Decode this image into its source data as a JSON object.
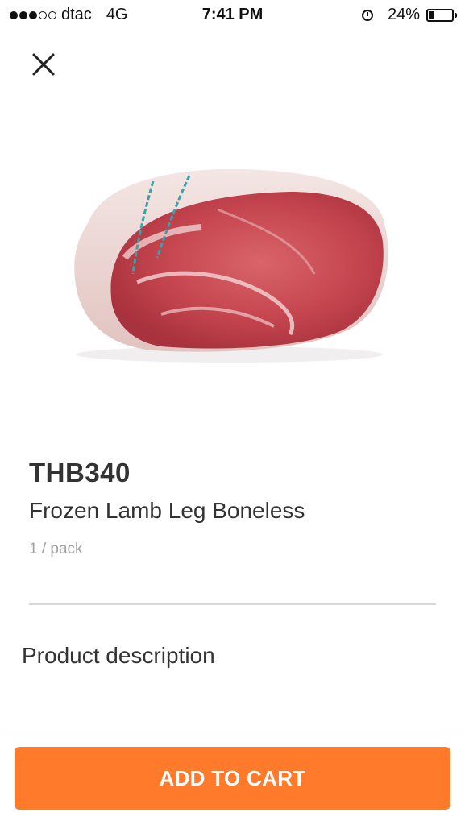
{
  "status_bar": {
    "carrier": "dtac",
    "network": "4G",
    "time": "7:41 PM",
    "battery_percent": "24%",
    "battery_level": 0.24,
    "signal_strength": 3,
    "signal_max": 5,
    "alarm_icon": "alarm-clock-icon"
  },
  "header": {
    "close_icon": "close-icon"
  },
  "product": {
    "image": "frozen-lamb-leg-image",
    "price": "THB340",
    "name": "Frozen Lamb Leg Boneless",
    "unit": "1 / pack"
  },
  "description": {
    "heading": "Product description"
  },
  "footer": {
    "add_to_cart_label": "ADD TO CART"
  },
  "colors": {
    "accent": "#ff7a2b",
    "text_primary": "#333333",
    "text_secondary": "#a0a0a0",
    "divider": "#d8d8d8"
  }
}
